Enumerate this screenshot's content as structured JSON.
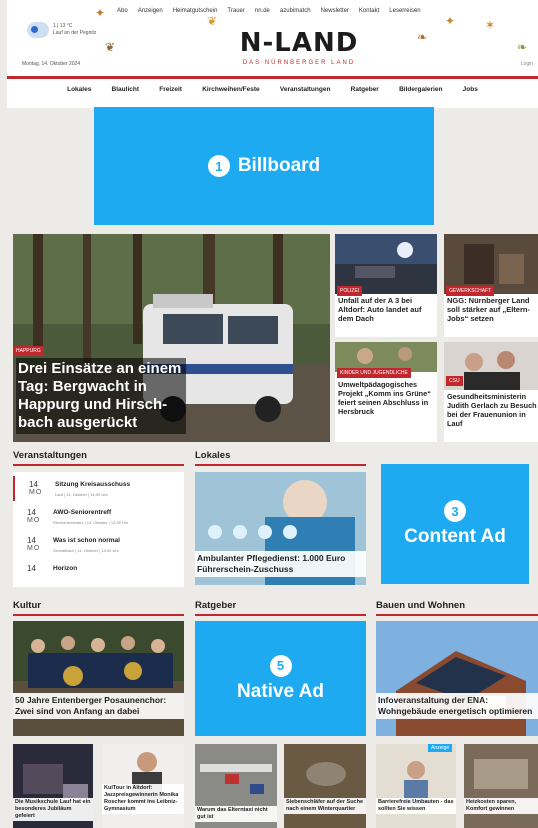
{
  "header": {
    "top_links": [
      "Abo",
      "Anzeigen",
      "Heimatgutschein",
      "Trauer",
      "nn.de",
      "azubimatch",
      "Newsletter",
      "Kontakt",
      "Leserreisen"
    ],
    "weather_temp": "1 | 13 °C",
    "weather_location": "Lauf an der Pegnitz",
    "date": "Montag, 14. Oktober 2024",
    "logo": "N-LAND",
    "logo_sub": "DAS NÜRNBERGER LAND",
    "login": "Login",
    "nav": [
      "Lokales",
      "Blaulicht",
      "Freizeit",
      "Kirchweihen/Feste",
      "Veranstaltungen",
      "Ratgeber",
      "Bildergalerien",
      "Jobs"
    ]
  },
  "ads": {
    "billboard": {
      "num": "1",
      "label": "Billboard"
    },
    "content": {
      "num": "3",
      "label": "Content Ad"
    },
    "native": {
      "num": "5",
      "label": "Native Ad"
    }
  },
  "hero": {
    "tag": "HAPPURG",
    "title": "Drei Einsätze an einem Tag: Bergwacht in Happurg und Hirsch­bach ausgerückt"
  },
  "teasers": [
    {
      "tag": "POLIZEI",
      "title": "Unfall auf der A 3 bei Altdorf: Auto landet auf dem Dach"
    },
    {
      "tag": "GEWERKSCHAFT",
      "title": "NGG: Nürnberger Land soll stärker auf „Eltern-Jobs“ setzen"
    },
    {
      "tag": "KINDER UND JUGENDLICHE",
      "title": "Umweltpädagogi­sches Projekt „Komm ins Grüne“ feiert sei­nen Abschluss in Hersbruck"
    },
    {
      "tag": "CSU",
      "title": "Gesundheitsministe­rin Judith Gerlach zu Besuch bei der Frau­enunion in Lauf"
    }
  ],
  "sections": {
    "veranstaltungen": "Veranstaltungen",
    "lokales": "Lokales",
    "kultur": "Kultur",
    "ratgeber": "Ratgeber",
    "bauen": "Bauen und Wohnen"
  },
  "events": [
    {
      "day": "14",
      "month": "MO",
      "title": "Sitzung Kreisausschuss",
      "sub": "Lauf | 14. Oktober | 14:00 Uhr"
    },
    {
      "day": "14",
      "month": "MO",
      "title": "AWO-Seniorentreff",
      "sub": "Reichenschwand | 14. Oktober | 13:30 Uhr"
    },
    {
      "day": "14",
      "month": "MO",
      "title": "Was ist schon normal",
      "sub": "Schnaittach | 14. Oktober | 14:00 Uhr"
    },
    {
      "day": "14",
      "month": "MO",
      "title": "Horizon",
      "sub": ""
    }
  ],
  "lokales_card": {
    "title": "Ambulanter Pflegedienst: 1.000 Euro Führerschein-Zuschuss"
  },
  "kultur_card": {
    "title": "50 Jahre Entenberger Posaunen­chor: Zwei sind von Anfang an dabei"
  },
  "bauen_card": {
    "title": "Infoveranstaltung der ENA: Wohngebäude energetisch opti­mieren"
  },
  "bottom_row": [
    {
      "title": "Die Musikschule Lauf hat ein besonderes Jubiläum gefeiert"
    },
    {
      "title": "KulTour in Altdorf: Jazzpreisgewinnerin Monika Roscher kommt ins Leibniz-Gymnasium"
    },
    {
      "title": "Warum das Elterntaxi nicht gut ist"
    },
    {
      "title": "Siebenschläfer auf der Suche nach einem Winterquartier"
    },
    {
      "title": "Barrierefreie Umbau­ten - das sollten Sie wissen",
      "badge": "Anzeige"
    },
    {
      "title": "Heizkosten sparen, Komfort gewinnen"
    }
  ],
  "colors": {
    "accent": "#c0282d",
    "ad": "#1eaaf0"
  }
}
